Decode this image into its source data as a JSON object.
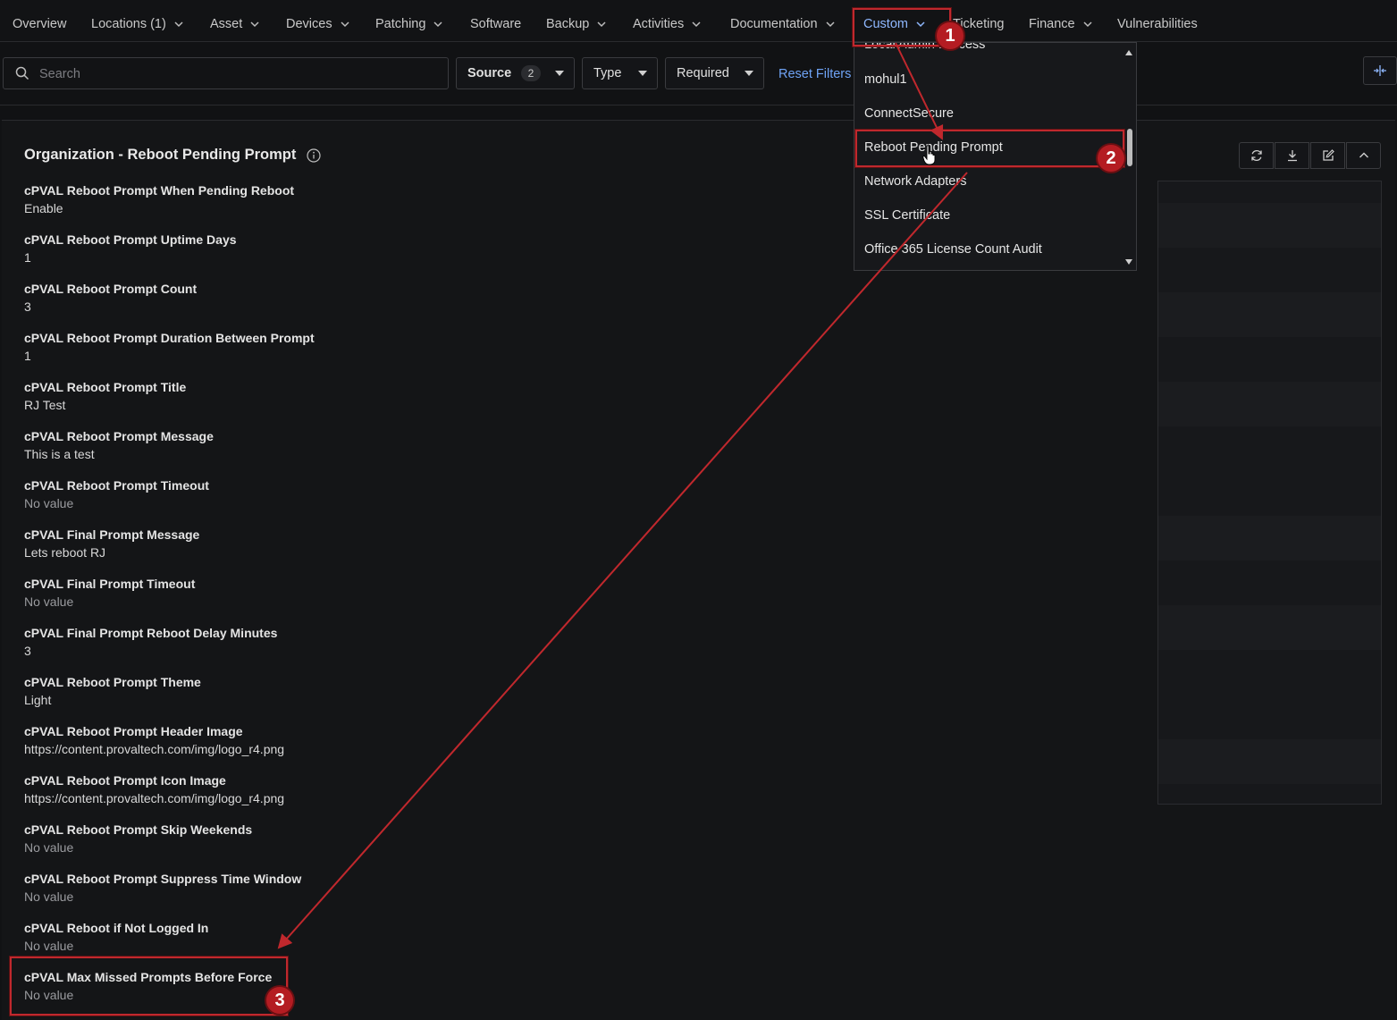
{
  "nav": {
    "items": [
      {
        "label": "Overview",
        "chevron": false
      },
      {
        "label": "Locations (1)",
        "chevron": true
      },
      {
        "label": "Asset",
        "chevron": true
      },
      {
        "label": "Devices",
        "chevron": true
      },
      {
        "label": "Patching",
        "chevron": true
      },
      {
        "label": "Software",
        "chevron": false
      },
      {
        "label": "Backup",
        "chevron": true
      },
      {
        "label": "Activities",
        "chevron": true
      },
      {
        "label": "Documentation",
        "chevron": true
      },
      {
        "label": "Custom",
        "chevron": true,
        "active": true
      },
      {
        "label": "Ticketing",
        "chevron": false
      },
      {
        "label": "Finance",
        "chevron": true
      },
      {
        "label": "Vulnerabilities",
        "chevron": false
      }
    ]
  },
  "filters": {
    "search_placeholder": "Search",
    "source_label": "Source",
    "source_count": "2",
    "type_label": "Type",
    "required_label": "Required",
    "reset_label": "Reset Filters"
  },
  "custom_menu": {
    "partial_item": "Local Admin Process",
    "items": [
      "mohul1",
      "ConnectSecure",
      "Reboot Pending Prompt",
      "Network Adapters",
      "SSL Certificate",
      "Office 365 License Count Audit"
    ]
  },
  "panel": {
    "title": "Organization - Reboot Pending Prompt",
    "fields": [
      {
        "label": "cPVAL Reboot Prompt When Pending Reboot",
        "value": "Enable"
      },
      {
        "label": "cPVAL Reboot Prompt Uptime Days",
        "value": "1"
      },
      {
        "label": "cPVAL Reboot Prompt Count",
        "value": "3"
      },
      {
        "label": "cPVAL Reboot Prompt Duration Between Prompt",
        "value": "1"
      },
      {
        "label": "cPVAL Reboot Prompt Title",
        "value": "RJ Test"
      },
      {
        "label": "cPVAL Reboot Prompt Message",
        "value": "This is a test"
      },
      {
        "label": "cPVAL Reboot Prompt Timeout",
        "value": "No value"
      },
      {
        "label": "cPVAL Final Prompt Message",
        "value": "Lets reboot RJ"
      },
      {
        "label": "cPVAL Final Prompt Timeout",
        "value": "No value"
      },
      {
        "label": "cPVAL Final Prompt Reboot Delay Minutes",
        "value": "3"
      },
      {
        "label": "cPVAL Reboot Prompt Theme",
        "value": "Light"
      },
      {
        "label": "cPVAL Reboot Prompt Header Image",
        "value": "https://content.provaltech.com/img/logo_r4.png"
      },
      {
        "label": "cPVAL Reboot Prompt Icon Image",
        "value": "https://content.provaltech.com/img/logo_r4.png"
      },
      {
        "label": "cPVAL Reboot Prompt Skip Weekends",
        "value": "No value"
      },
      {
        "label": "cPVAL Reboot Prompt Suppress Time Window",
        "value": "No value"
      },
      {
        "label": "cPVAL Reboot if Not Logged In",
        "value": "No value"
      },
      {
        "label": "cPVAL Max Missed Prompts Before Force",
        "value": "No value"
      }
    ]
  },
  "annotations": {
    "badges": [
      "1",
      "2",
      "3"
    ],
    "color": "#c0282d"
  },
  "colors": {
    "background": "#111214",
    "accent": "#8fb8ff",
    "link": "#6fa3f5",
    "annotation": "#c0282d"
  }
}
